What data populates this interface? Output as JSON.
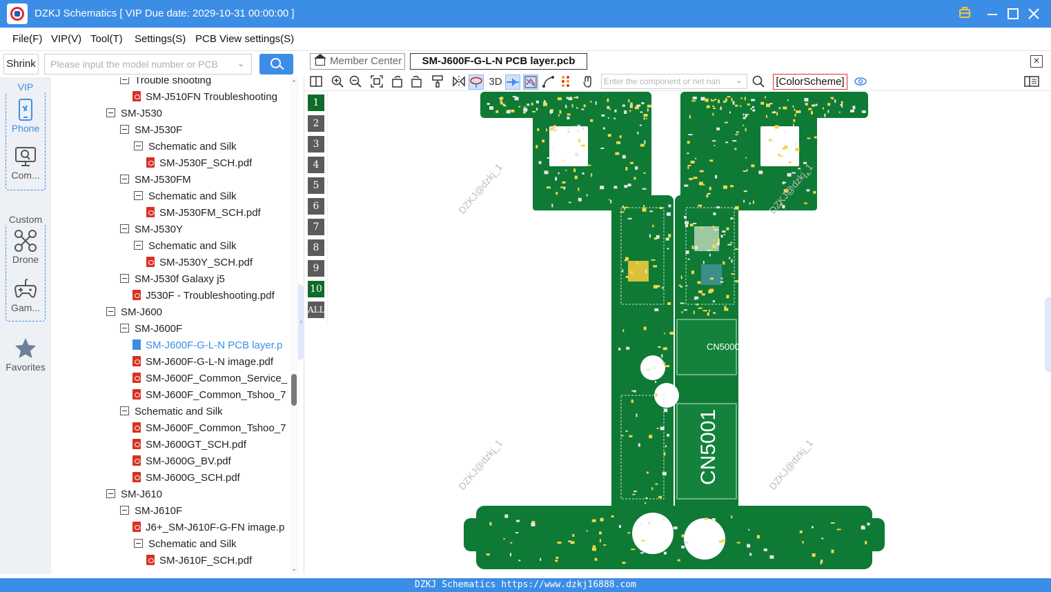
{
  "window": {
    "title": "DZKJ Schematics [ VIP Due date: 2029-10-31 00:00:00 ]"
  },
  "menu": {
    "items": [
      "File(F)",
      "VIP(V)",
      "Tool(T)",
      "Settings(S)",
      "PCB View settings(S)"
    ]
  },
  "left_toolbar": {
    "shrink_label": "Shrink",
    "search_placeholder": "Please input the model number or PCB"
  },
  "rail": {
    "vip_caption": "VIP",
    "custom_caption": "Custom",
    "vip_items": [
      {
        "label": "Phone",
        "icon": "phone-icon",
        "active": true
      },
      {
        "label": "Com...",
        "icon": "computer-icon",
        "active": false
      }
    ],
    "custom_items": [
      {
        "label": "Drone",
        "icon": "drone-icon"
      },
      {
        "label": "Gam...",
        "icon": "gamepad-icon"
      }
    ],
    "favorites_label": "Favorites"
  },
  "tree": [
    {
      "label": "Trouble shooting",
      "level": 1,
      "kind": "folder"
    },
    {
      "label": "SM-J510FN Troubleshooting",
      "level": 2,
      "kind": "pdf"
    },
    {
      "label": "SM-J530",
      "level": 0,
      "kind": "folder"
    },
    {
      "label": "SM-J530F",
      "level": 1,
      "kind": "folder"
    },
    {
      "label": "Schematic and Silk",
      "level": 2,
      "kind": "folder"
    },
    {
      "label": "SM-J530F_SCH.pdf",
      "level": 3,
      "kind": "pdf"
    },
    {
      "label": "SM-J530FM",
      "level": 1,
      "kind": "folder"
    },
    {
      "label": "Schematic and Silk",
      "level": 2,
      "kind": "folder"
    },
    {
      "label": "SM-J530FM_SCH.pdf",
      "level": 3,
      "kind": "pdf"
    },
    {
      "label": "SM-J530Y",
      "level": 1,
      "kind": "folder"
    },
    {
      "label": "Schematic and Silk",
      "level": 2,
      "kind": "folder"
    },
    {
      "label": "SM-J530Y_SCH.pdf",
      "level": 3,
      "kind": "pdf"
    },
    {
      "label": "SM-J530f Galaxy j5",
      "level": 1,
      "kind": "folder"
    },
    {
      "label": "J530F - Troubleshooting.pdf",
      "level": 2,
      "kind": "pdf"
    },
    {
      "label": "SM-J600",
      "level": 0,
      "kind": "folder"
    },
    {
      "label": "SM-J600F",
      "level": 1,
      "kind": "folder"
    },
    {
      "label": "SM-J600F-G-L-N PCB layer.p",
      "level": 2,
      "kind": "pcb",
      "selected": true
    },
    {
      "label": "SM-J600F-G-L-N image.pdf",
      "level": 2,
      "kind": "pdf"
    },
    {
      "label": "SM-J600F_Common_Service_",
      "level": 2,
      "kind": "pdf"
    },
    {
      "label": "SM-J600F_Common_Tshoo_7",
      "level": 2,
      "kind": "pdf"
    },
    {
      "label": "Schematic and Silk",
      "level": 1,
      "kind": "folder"
    },
    {
      "label": "SM-J600F_Common_Tshoo_7",
      "level": 2,
      "kind": "pdf"
    },
    {
      "label": "SM-J600GT_SCH.pdf",
      "level": 2,
      "kind": "pdf"
    },
    {
      "label": "SM-J600G_BV.pdf",
      "level": 2,
      "kind": "pdf"
    },
    {
      "label": "SM-J600G_SCH.pdf",
      "level": 2,
      "kind": "pdf"
    },
    {
      "label": "SM-J610",
      "level": 0,
      "kind": "folder"
    },
    {
      "label": "SM-J610F",
      "level": 1,
      "kind": "folder"
    },
    {
      "label": "J6+_SM-J610F-G-FN image.p",
      "level": 2,
      "kind": "pdf"
    },
    {
      "label": "Schematic and Silk",
      "level": 2,
      "kind": "folder"
    },
    {
      "label": "SM-J610F_SCH.pdf",
      "level": 3,
      "kind": "pdf"
    }
  ],
  "tabs": {
    "member_center": "Member Center",
    "active_file": "SM-J600F-G-L-N PCB layer.pcb"
  },
  "pcb_toolbar": {
    "three_d_label": "3D",
    "net_search_placeholder": "Enter the component or net nan",
    "color_scheme_label": "[ColorScheme]"
  },
  "layers": {
    "labels": [
      "1",
      "2",
      "3",
      "4",
      "5",
      "6",
      "7",
      "8",
      "9",
      "10",
      "ALL"
    ],
    "active": [
      "1",
      "10"
    ]
  },
  "board": {
    "board_color": "#0e7a35",
    "component_labels": [
      "CN5000",
      "CN5001"
    ],
    "watermark": "DZKJ@dzkj_1"
  },
  "status": {
    "text": "DZKJ Schematics https://www.dzkj16888.com"
  },
  "colors": {
    "accent": "#3c8de6",
    "pdf_icon": "#d93025",
    "layer_active": "#0e6b2a"
  }
}
